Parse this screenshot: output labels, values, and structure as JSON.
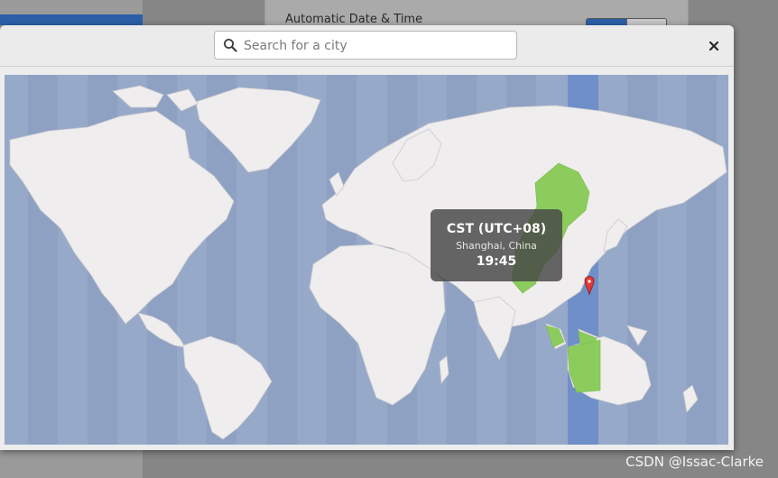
{
  "background": {
    "automatic_label": "Automatic Date & Time"
  },
  "dialog": {
    "search": {
      "placeholder": "Search for a city",
      "value": ""
    },
    "close_glyph": "×",
    "map": {
      "selected_zone_highlight": "#8ccc5c",
      "marker": "location-pin-icon",
      "tooltip": {
        "timezone": "CST (UTC+08)",
        "city": "Shanghai, China",
        "time": "19:45"
      }
    }
  },
  "colors": {
    "ocean": "#97a9c8",
    "land": "#efeded",
    "selected_band": "#6f8fc9",
    "highlight": "#8ccc5c"
  },
  "watermark": "CSDN @Issac-Clarke"
}
